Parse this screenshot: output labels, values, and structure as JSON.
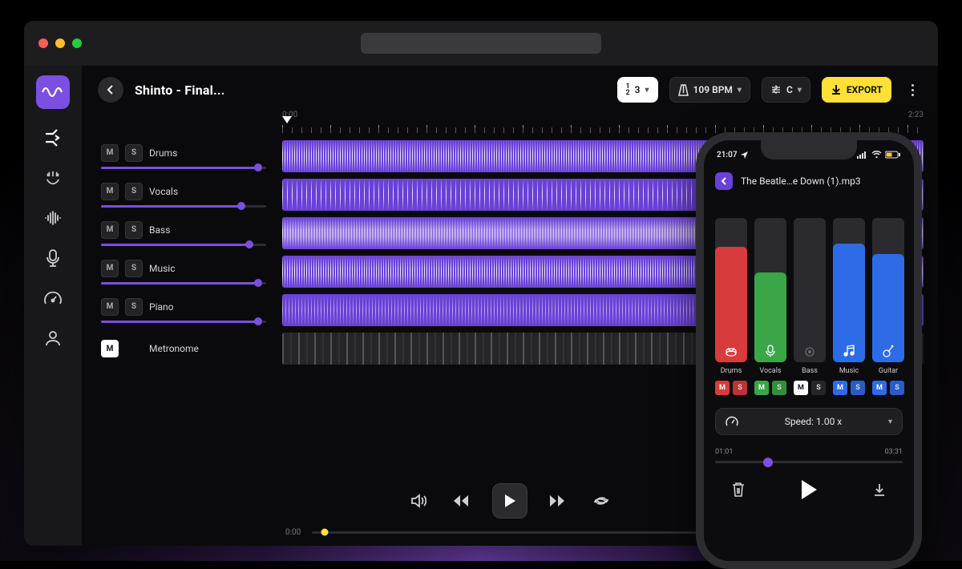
{
  "colors": {
    "accent": "#7b4fe0",
    "yellow": "#ffe038"
  },
  "header": {
    "title": "Shinto - Final...",
    "timesig": "1 2 3",
    "bpm": "109 BPM",
    "key": "C",
    "export_label": "EXPORT"
  },
  "timeline": {
    "start": "0:00",
    "end": "2:23"
  },
  "tracks": [
    {
      "name": "Drums",
      "mute": false,
      "solo": false,
      "volume": 0.95,
      "kind": "drums"
    },
    {
      "name": "Vocals",
      "mute": false,
      "solo": false,
      "volume": 0.85,
      "kind": "vocals"
    },
    {
      "name": "Bass",
      "mute": false,
      "solo": false,
      "volume": 0.9,
      "kind": "bass"
    },
    {
      "name": "Music",
      "mute": false,
      "solo": false,
      "volume": 0.95,
      "kind": "music"
    },
    {
      "name": "Piano",
      "mute": false,
      "solo": false,
      "volume": 0.95,
      "kind": "piano"
    },
    {
      "name": "Metronome",
      "mute": true,
      "solo": null,
      "volume": null,
      "kind": "metro"
    }
  ],
  "transport": {
    "current": "0:00",
    "seek_pct": 3
  },
  "phone": {
    "clock": "21:07",
    "title": "The Beatle…e Down (1).mp3",
    "speed_label": "Speed: 1.00 x",
    "time_start": "01:01",
    "time_end": "03:31",
    "seek_pct": 28,
    "stems": [
      {
        "name": "Drums",
        "color": "#d83b3b",
        "level": 0.8,
        "mute": false,
        "solo": false
      },
      {
        "name": "Vocals",
        "color": "#3aa648",
        "level": 0.62,
        "mute": false,
        "solo": false
      },
      {
        "name": "Bass",
        "color": "#2b2b2f",
        "level": 0.0,
        "mute": true,
        "solo": false,
        "dim": true
      },
      {
        "name": "Music",
        "color": "#2e6be6",
        "level": 0.82,
        "mute": false,
        "solo": false
      },
      {
        "name": "Guitar",
        "color": "#2e6be6",
        "level": 0.75,
        "mute": false,
        "solo": false
      }
    ]
  }
}
